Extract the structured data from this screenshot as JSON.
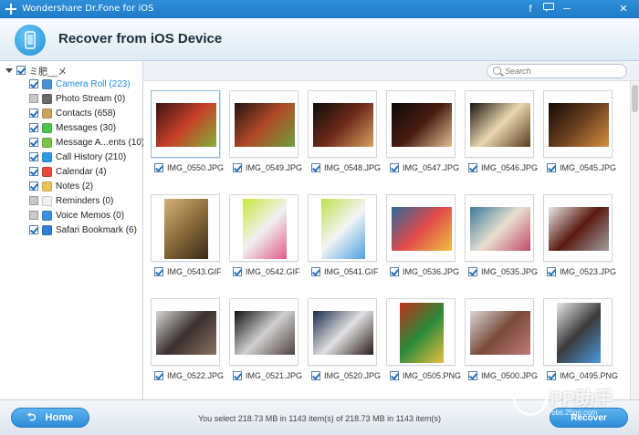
{
  "app": {
    "title": "Wondershare Dr.Fone for iOS"
  },
  "titlebar_buttons": [
    {
      "name": "facebook-icon",
      "glyph": "f"
    },
    {
      "name": "feedback-icon",
      "glyph": "▭"
    },
    {
      "name": "minimize-button",
      "glyph": "─"
    },
    {
      "name": "close-button",
      "glyph": "✕"
    }
  ],
  "header": {
    "title": "Recover from iOS Device"
  },
  "sidebar": {
    "root_label": "ミ肥__メ",
    "items": [
      {
        "label": "Camera Roll (223)",
        "checked": true,
        "active": true,
        "icon": "camera-roll-icon",
        "color": "#4a8fd6"
      },
      {
        "label": "Photo Stream (0)",
        "checked": false,
        "active": false,
        "icon": "photo-stream-icon",
        "color": "#6a6a6a"
      },
      {
        "label": "Contacts (658)",
        "checked": true,
        "active": false,
        "icon": "contacts-icon",
        "color": "#c9a35a"
      },
      {
        "label": "Messages (30)",
        "checked": true,
        "active": false,
        "icon": "messages-icon",
        "color": "#4cc34c"
      },
      {
        "label": "Message A...ents (10)",
        "checked": true,
        "active": false,
        "icon": "message-attachments-icon",
        "color": "#7cc34a"
      },
      {
        "label": "Call History (210)",
        "checked": true,
        "active": false,
        "icon": "call-history-icon",
        "color": "#2f9be3"
      },
      {
        "label": "Calendar (4)",
        "checked": true,
        "active": false,
        "icon": "calendar-icon",
        "color": "#e24b3b"
      },
      {
        "label": "Notes (2)",
        "checked": true,
        "active": false,
        "icon": "notes-icon",
        "color": "#e8c45a"
      },
      {
        "label": "Reminders (0)",
        "checked": false,
        "active": false,
        "icon": "reminders-icon",
        "color": "#f0f0f0"
      },
      {
        "label": "Voice Memos (0)",
        "checked": false,
        "active": false,
        "icon": "voice-memos-icon",
        "color": "#3b8fe0"
      },
      {
        "label": "Safari Bookmark (6)",
        "checked": true,
        "active": false,
        "icon": "safari-bookmark-icon",
        "color": "#2f7fd6"
      }
    ]
  },
  "search": {
    "placeholder": "Search"
  },
  "photos": [
    {
      "name": "IMG_0550.JPG",
      "orientation": "landscape",
      "colors": [
        "#3a1410",
        "#c8402a",
        "#7fb236"
      ]
    },
    {
      "name": "IMG_0549.JPG",
      "orientation": "landscape",
      "colors": [
        "#241410",
        "#b24a2a",
        "#6aa03a"
      ]
    },
    {
      "name": "IMG_0548.JPG",
      "orientation": "landscape",
      "colors": [
        "#0e0c0c",
        "#6e2a1a",
        "#d8a060"
      ]
    },
    {
      "name": "IMG_0547.JPG",
      "orientation": "landscape",
      "colors": [
        "#0c0a0a",
        "#4a1c14",
        "#e0c090"
      ]
    },
    {
      "name": "IMG_0546.JPG",
      "orientation": "landscape",
      "colors": [
        "#1a1410",
        "#e8d8b0",
        "#5a3a20"
      ]
    },
    {
      "name": "IMG_0545.JPG",
      "orientation": "landscape",
      "colors": [
        "#120c08",
        "#6a4020",
        "#d89040"
      ]
    },
    {
      "name": "IMG_0543.GIF",
      "orientation": "portrait",
      "colors": [
        "#d4b378",
        "#8a6a3a",
        "#3a2a18"
      ]
    },
    {
      "name": "IMG_0542.GIF",
      "orientation": "portrait",
      "colors": [
        "#c8e83a",
        "#f0f0f0",
        "#e05a8a"
      ]
    },
    {
      "name": "IMG_0541.GIF",
      "orientation": "portrait",
      "colors": [
        "#bfe04a",
        "#f4f4f4",
        "#4aa0e0"
      ]
    },
    {
      "name": "IMG_0536.JPG",
      "orientation": "landscape",
      "colors": [
        "#2a6a9a",
        "#e04a4a",
        "#f0c040"
      ]
    },
    {
      "name": "IMG_0535.JPG",
      "orientation": "landscape",
      "colors": [
        "#3a7a9a",
        "#e8e0d0",
        "#c04a6a"
      ]
    },
    {
      "name": "IMG_0523.JPG",
      "orientation": "landscape",
      "colors": [
        "#e8e8e8",
        "#5a1a10",
        "#a0a0a0"
      ]
    },
    {
      "name": "IMG_0522.JPG",
      "orientation": "landscape",
      "colors": [
        "#d8d8d8",
        "#3a3030",
        "#8a7060"
      ]
    },
    {
      "name": "IMG_0521.JPG",
      "orientation": "landscape",
      "colors": [
        "#101010",
        "#d0d0d0",
        "#504040"
      ]
    },
    {
      "name": "IMG_0520.JPG",
      "orientation": "landscape",
      "colors": [
        "#1a2a4a",
        "#e0e0e0",
        "#2a1a1a"
      ]
    },
    {
      "name": "IMG_0505.PNG",
      "orientation": "portrait",
      "colors": [
        "#c0301a",
        "#2a8a3a",
        "#e8c040"
      ]
    },
    {
      "name": "IMG_0500.JPG",
      "orientation": "landscape",
      "colors": [
        "#d8d8d8",
        "#7a4a3a",
        "#c07a7a"
      ]
    },
    {
      "name": "IMG_0495.PNG",
      "orientation": "portrait",
      "colors": [
        "#e8e8e8",
        "#3a3a3a",
        "#4a9ae0"
      ]
    }
  ],
  "footer": {
    "home_label": "Home",
    "status": "You select 218.73 MB in 1143 item(s) of 218.73 MB in 1143 item(s)",
    "recover_label": "Recover"
  },
  "watermark": {
    "text": "PP助手",
    "url": "bbs.25pp.com"
  }
}
